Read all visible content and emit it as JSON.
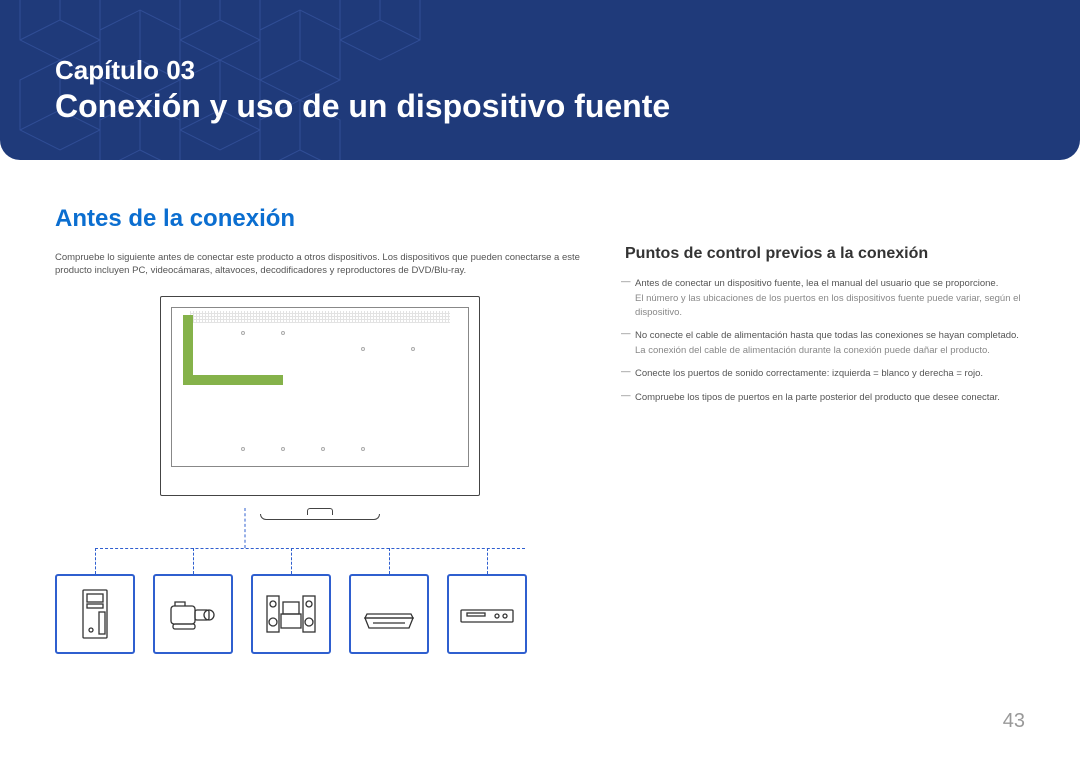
{
  "banner": {
    "chapter_label": "Capítulo 03",
    "chapter_title": "Conexión y uso de un dispositivo fuente"
  },
  "section_heading": "Antes de la conexión",
  "intro_text": "Compruebe lo siguiente antes de conectar este producto a otros dispositivos. Los dispositivos que pueden conectarse a este producto incluyen PC, videocámaras, altavoces, decodificadores y reproductores de DVD/Blu-ray.",
  "subheading": "Puntos de control previos a la conexión",
  "tips": [
    {
      "main": "Antes de conectar un dispositivo fuente, lea el manual del usuario que se proporcione.",
      "sub": "El número y las ubicaciones de los puertos en los dispositivos fuente puede variar, según el dispositivo."
    },
    {
      "main": "No conecte el cable de alimentación hasta que todas las conexiones se hayan completado.",
      "sub": "La conexión del cable de alimentación durante la conexión puede dañar el producto."
    },
    {
      "main": "Conecte los puertos de sonido correctamente: izquierda = blanco y derecha = rojo.",
      "sub": ""
    },
    {
      "main": "Compruebe los tipos de puertos en la parte posterior del producto que desee conectar.",
      "sub": ""
    }
  ],
  "devices": [
    {
      "name": "pc-tower-icon"
    },
    {
      "name": "camcorder-icon"
    },
    {
      "name": "stereo-speakers-icon"
    },
    {
      "name": "settop-box-icon"
    },
    {
      "name": "dvd-player-icon"
    }
  ],
  "page_number": "43"
}
